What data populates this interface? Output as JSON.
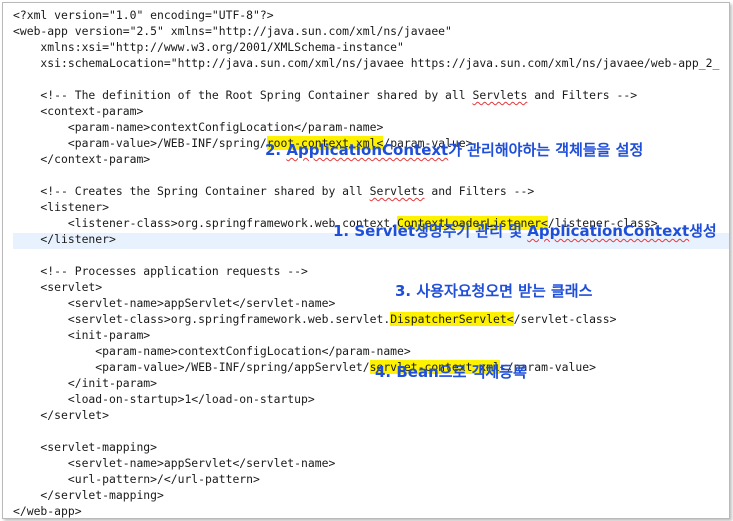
{
  "code": {
    "l1": "<?xml version=\"1.0\" encoding=\"UTF-8\"?>",
    "l2": "<web-app version=\"2.5\" xmlns=\"http://java.sun.com/xml/ns/javaee\"",
    "l3": "    xmlns:xsi=\"http://www.w3.org/2001/XMLSchema-instance\"",
    "l4": "    xsi:schemaLocation=\"http://java.sun.com/xml/ns/javaee https://java.sun.com/xml/ns/javaee/web-app_2_",
    "l6a": "    <!-- The definition of the Root Spring Container shared by all ",
    "l6b": "Servlets",
    "l6c": " and Filters -->",
    "l7": "    <context-param>",
    "l8": "        <param-name>contextConfigLocation</param-name>",
    "l9a": "        <param-value>/WEB-INF/spring/",
    "l9b": "root-context.xml<",
    "l9c": "/param-value>",
    "l10": "    </context-param>",
    "l12a": "    <!-- Creates the Spring Container shared by all ",
    "l12b": "Servlets",
    "l12c": " and Filters -->",
    "l13": "    <listener>",
    "l14a": "        <listener-class>org.springframework.web.context.",
    "l14b": "ContextLoaderListener<",
    "l14c": "/listener-class>",
    "l15": "    </listener>",
    "l17": "    <!-- Processes application requests -->",
    "l18": "    <servlet>",
    "l19": "        <servlet-name>appServlet</servlet-name>",
    "l20a": "        <servlet-class>org.springframework.web.servlet.",
    "l20b": "DispatcherServlet<",
    "l20c": "/servlet-class>",
    "l21": "        <init-param>",
    "l22": "            <param-name>contextConfigLocation</param-name>",
    "l23a": "            <param-value>/WEB-INF/spring/appServlet/",
    "l23b": "servlet-context.xml",
    "l23c": "</param-value>",
    "l24": "        </init-param>",
    "l25": "        <load-on-startup>1</load-on-startup>",
    "l26": "    </servlet>",
    "l28": "    <servlet-mapping>",
    "l29": "        <servlet-name>appServlet</servlet-name>",
    "l30": "        <url-pattern>/</url-pattern>",
    "l31": "    </servlet-mapping>",
    "l33": "</web-app>"
  },
  "annotations": {
    "a2a": "2. ",
    "a2b": "ApplicationContext",
    "a2c": "가 관리해야하는 객체들을 설정",
    "a1a": "1. Servlet생명주기 관리 및 ",
    "a1b": "ApplicationContext",
    "a1c": "생성",
    "a3": "3. 사용자요청오면 받는 클래스",
    "a4": "4. Bean으로 객체등록"
  },
  "colors": {
    "annotation": "#1f4fd8",
    "highlight": "#fff200",
    "current_line": "#e8f2fe"
  }
}
